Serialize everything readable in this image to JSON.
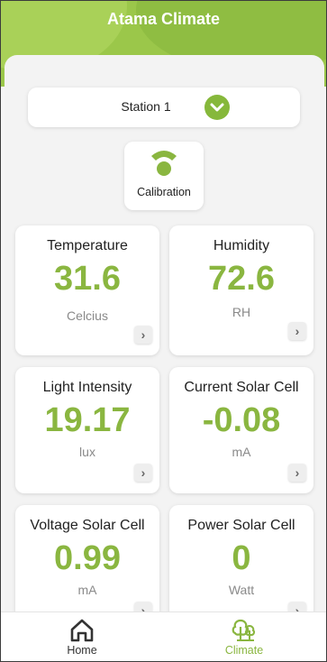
{
  "app": {
    "title": "Atama Climate"
  },
  "station": {
    "label": "Station 1"
  },
  "calibration": {
    "label": "Calibration"
  },
  "cards": [
    {
      "title": "Temperature",
      "value": "31.6",
      "unit": "Celcius"
    },
    {
      "title": "Humidity",
      "value": "72.6",
      "unit": "RH"
    },
    {
      "title": "Light Intensity",
      "value": "19.17",
      "unit": "lux"
    },
    {
      "title": "Current Solar Cell",
      "value": "-0.08",
      "unit": "mA"
    },
    {
      "title": "Voltage Solar Cell",
      "value": "0.99",
      "unit": "mA"
    },
    {
      "title": "Power Solar Cell",
      "value": "0",
      "unit": "Watt"
    }
  ],
  "nav": {
    "home": {
      "label": "Home"
    },
    "climate": {
      "label": "Climate"
    }
  },
  "icons": {
    "chevron": "chevron-down-icon",
    "calibration": "wifi-signal-icon",
    "more": "chevron-right-icon",
    "home": "home-icon",
    "climate": "tree-icon"
  },
  "colors": {
    "accent": "#8ab640",
    "header": "#9bc74a",
    "inactive": "#333333"
  }
}
